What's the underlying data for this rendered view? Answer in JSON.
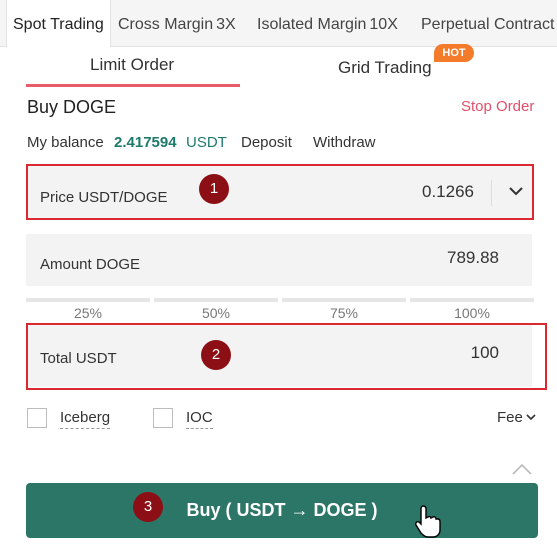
{
  "top_tabs": [
    {
      "label": "Spot Trading",
      "leverage": ""
    },
    {
      "label": "Cross Margin",
      "leverage": "3X"
    },
    {
      "label": "Isolated Margin",
      "leverage": "10X"
    },
    {
      "label": "Perpetual Contract",
      "leverage": ""
    }
  ],
  "sub_tabs": {
    "limit": "Limit Order",
    "grid": "Grid Trading",
    "hot_badge": "HOT"
  },
  "order": {
    "title": "Buy DOGE",
    "stop_order": "Stop Order"
  },
  "balance": {
    "label": "My balance",
    "amount": "2.417594",
    "currency": "USDT",
    "deposit": "Deposit",
    "withdraw": "Withdraw"
  },
  "fields": {
    "price_label": "Price USDT/DOGE",
    "price_value": "0.1266",
    "amount_label": "Amount DOGE",
    "amount_value": "789.88",
    "total_label": "Total USDT",
    "total_value": "100"
  },
  "percentages": [
    "25%",
    "50%",
    "75%",
    "100%"
  ],
  "options": {
    "iceberg": "Iceberg",
    "ioc": "IOC",
    "fee": "Fee"
  },
  "buy_button": "Buy ( USDT → DOGE )",
  "markers": [
    "1",
    "2",
    "3"
  ],
  "colors": {
    "accent": "#e85b6a",
    "buy": "#2c7668",
    "balance": "#1d7a6b",
    "highlight": "#d9282f",
    "hot": "#f47b2a"
  }
}
